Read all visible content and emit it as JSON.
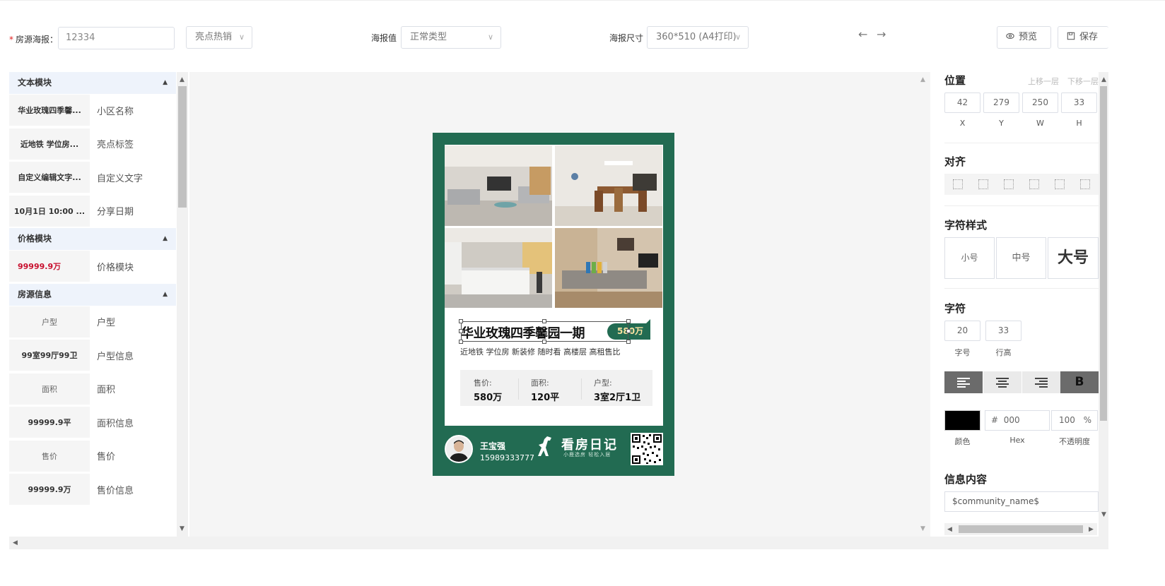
{
  "toolbar": {
    "poster_label": "房源海报",
    "poster_label_colon": "：",
    "required_mark": "*",
    "poster_input_value": "12334",
    "highlight_select": "亮点热销",
    "poster_value_label": "海报值",
    "poster_value_select": "正常类型",
    "poster_size_label": "海报尺寸",
    "poster_size_select": "360*510 (A4打印)",
    "undo": "←",
    "redo": "→",
    "preview_label": "预览",
    "save_label": "保存"
  },
  "left_panel": {
    "groups": [
      {
        "title": "文本模块",
        "rows": [
          {
            "key": "华业玫瑰四季馨...",
            "value": "小区名称"
          },
          {
            "key": "近地铁 学位房...",
            "value": "亮点标签"
          },
          {
            "key": "自定义编辑文字...",
            "value": "自定义文字"
          },
          {
            "key": "10月1日 10:00 ...",
            "value": "分享日期"
          }
        ]
      },
      {
        "title": "价格模块",
        "rows": [
          {
            "key": "99999.9万",
            "value": "价格模块"
          }
        ]
      },
      {
        "title": "房源信息",
        "rows": [
          {
            "key": "户型",
            "value": "户型"
          },
          {
            "key": "99室99厅99卫",
            "value": "户型信息"
          },
          {
            "key": "面积",
            "value": "面积"
          },
          {
            "key": "99999.9平",
            "value": "面积信息"
          },
          {
            "key": "售价",
            "value": "售价"
          },
          {
            "key": "99999.9万",
            "value": "售价信息"
          }
        ]
      }
    ]
  },
  "poster": {
    "title": "华业玫瑰四季馨园一期",
    "price_tag": "580万",
    "tags": "近地铁 学位房 新装修 随时看 高楼层 高租售比",
    "info": [
      {
        "label": "售价:",
        "value": "580万"
      },
      {
        "label": "面积:",
        "value": "120平"
      },
      {
        "label": "户型:",
        "value": "3室2厅1卫"
      }
    ],
    "agent_name": "王宝强",
    "agent_phone": "15989333777",
    "brand": "看房日记",
    "brand_sub": "小鹿选房 轻松入居",
    "colors": {
      "poster_bg": "#226b52",
      "price_text": "#f7e1a0"
    }
  },
  "right_panel": {
    "position_title": "位置",
    "layer_up": "上移一层",
    "layer_down": "下移一层",
    "position": [
      {
        "value": "42",
        "caption": "X"
      },
      {
        "value": "279",
        "caption": "Y"
      },
      {
        "value": "250",
        "caption": "W"
      },
      {
        "value": "33",
        "caption": "H"
      }
    ],
    "align_title": "对齐",
    "char_style_title": "字符样式",
    "sizes": {
      "small": "小号",
      "medium": "中号",
      "large": "大号"
    },
    "char_title": "字符",
    "font_size": "20",
    "font_size_caption": "字号",
    "line_height": "33",
    "line_height_caption": "行高",
    "bold_label": "B",
    "color_caption": "颜色",
    "hex_prefix": "#",
    "hex_value": "000",
    "hex_caption": "Hex",
    "opacity_value": "100",
    "opacity_unit": "%",
    "opacity_caption": "不透明度",
    "info_title": "信息内容",
    "info_value": "$community_name$",
    "color_swatch": "#000000"
  }
}
